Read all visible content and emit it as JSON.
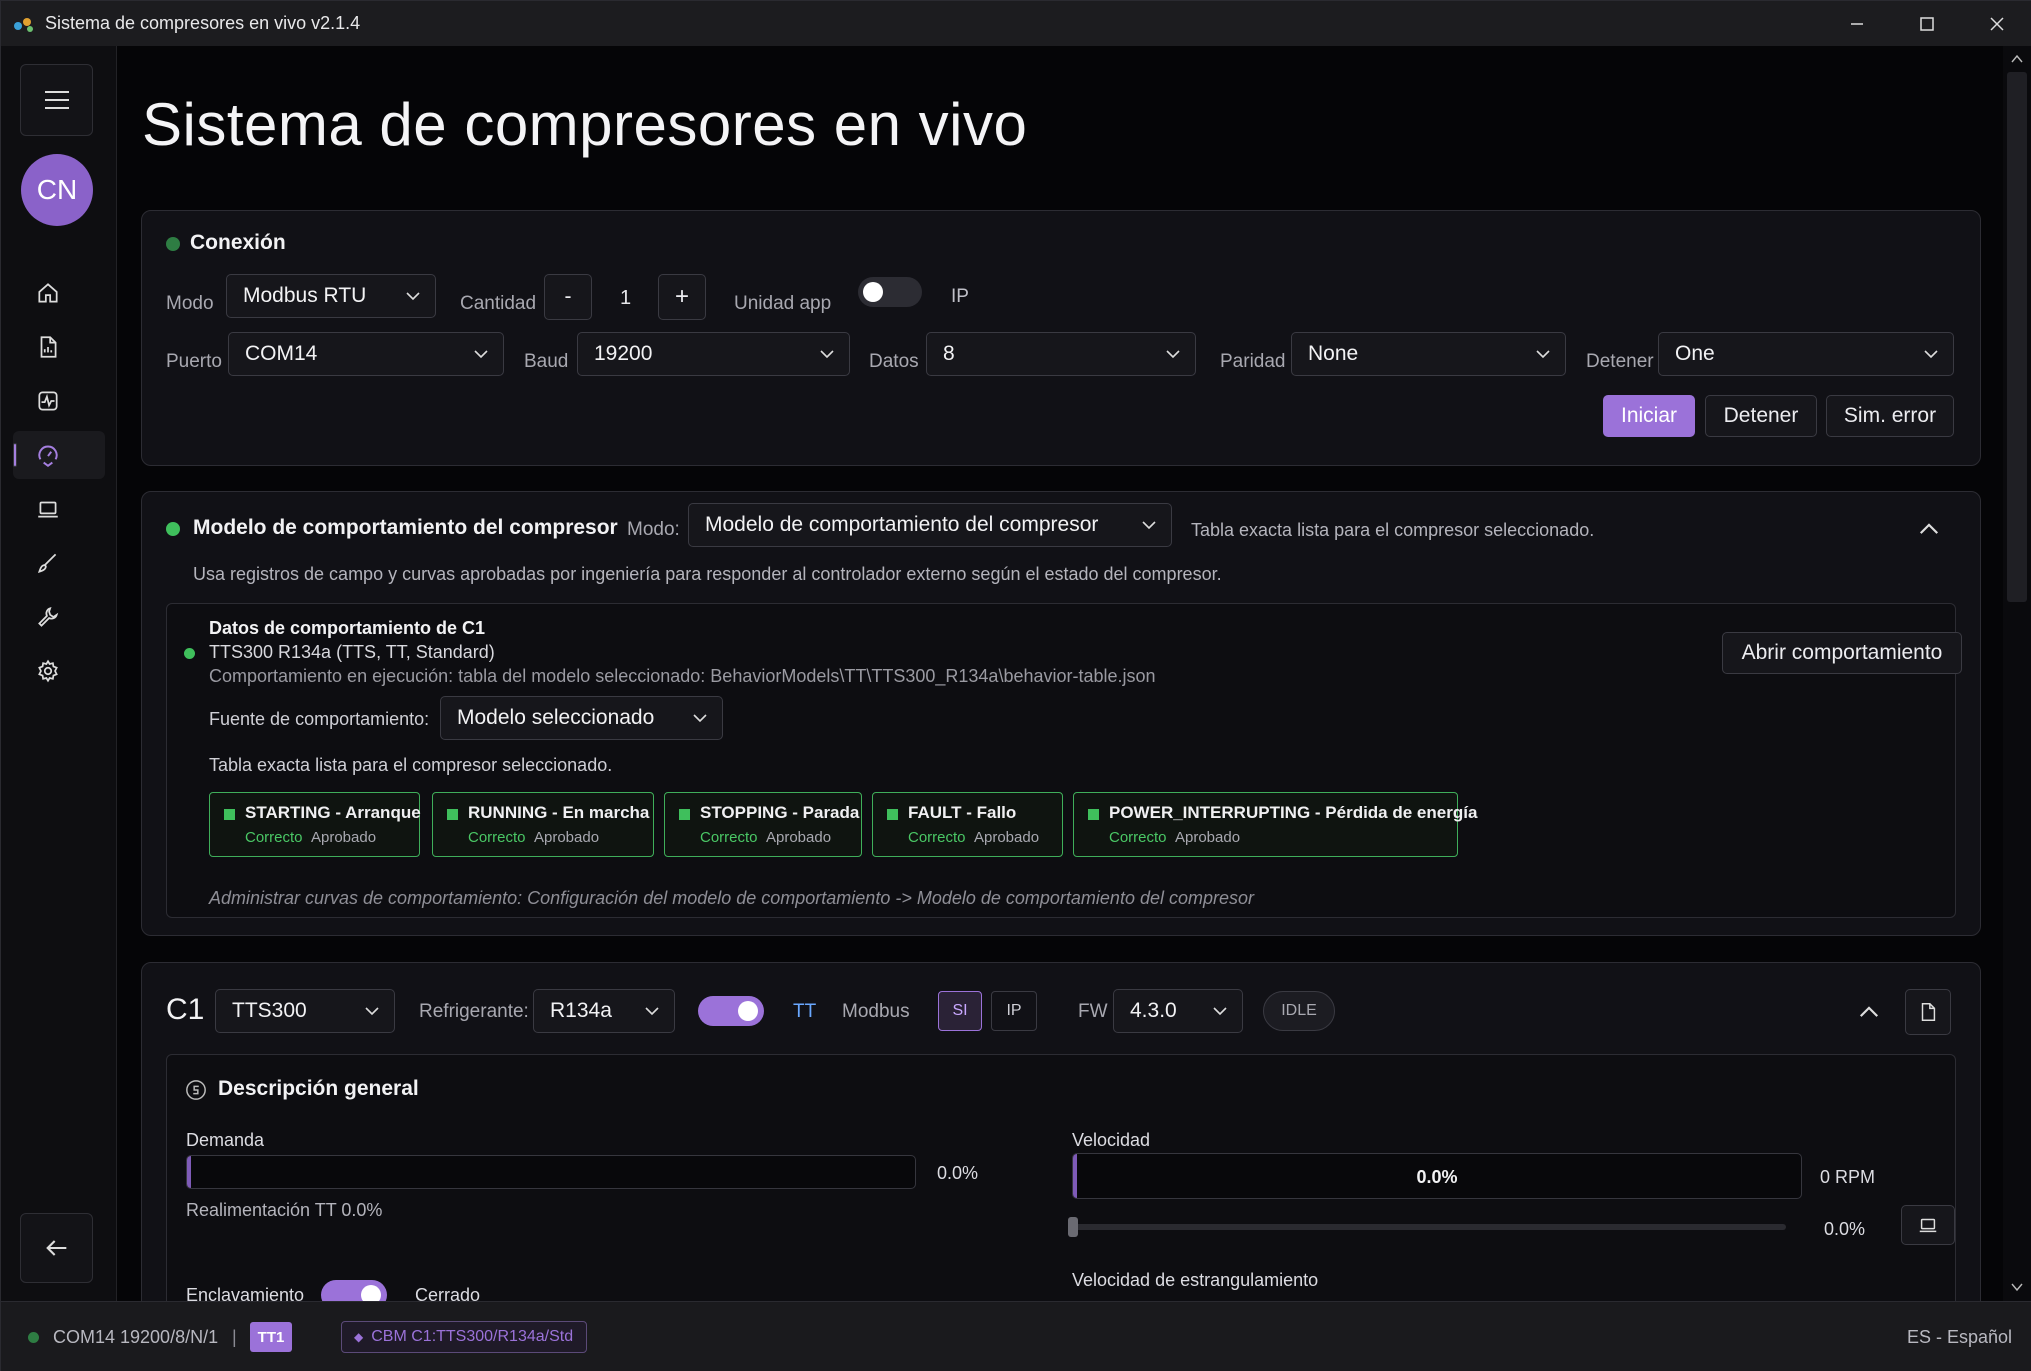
{
  "window": {
    "title": "Sistema de compresores en vivo v2.1.4"
  },
  "sidebar": {
    "avatar": "CN",
    "icons": [
      "home-icon",
      "report-icon",
      "activity-icon",
      "gauge-icon",
      "laptop-icon",
      "brush-icon",
      "wrench-icon",
      "gear-icon"
    ]
  },
  "page": {
    "title": "Sistema de compresores en vivo"
  },
  "connection": {
    "title": "Conexión",
    "mode_label": "Modo",
    "mode_value": "Modbus RTU",
    "qty_label": "Cantidad",
    "qty_minus": "-",
    "qty_value": "1",
    "qty_plus": "+",
    "unit_label": "Unidad app",
    "ip_label": "IP",
    "port_label": "Puerto",
    "port_value": "COM14",
    "baud_label": "Baud",
    "baud_value": "19200",
    "data_label": "Datos",
    "data_value": "8",
    "parity_label": "Paridad",
    "parity_value": "None",
    "stop_label": "Detener",
    "stop_value": "One",
    "start_btn": "Iniciar",
    "stop_btn": "Detener",
    "sim_btn": "Sim. error",
    "status_color": "#2e7d43"
  },
  "behavior": {
    "title": "Modelo de comportamiento del compresor",
    "mode_label": "Modo:",
    "mode_value": "Modelo de comportamiento del compresor",
    "table_note": "Tabla exacta lista para el compresor seleccionado.",
    "description": "Usa registros de campo y curvas aprobadas por ingeniería para responder al controlador externo según el estado del compresor.",
    "data_title": "Datos de comportamiento de C1",
    "model_line": "TTS300 R134a (TTS, TT, Standard)",
    "running_line": "Comportamiento en ejecución: tabla del modelo seleccionado: BehaviorModels\\TT\\TTS300_R134a\\behavior-table.json",
    "open_btn": "Abrir comportamiento",
    "source_label": "Fuente de comportamiento:",
    "source_value": "Modelo seleccionado",
    "table_ready": "Tabla exacta lista para el compresor seleccionado.",
    "states": [
      {
        "name": "STARTING - Arranque",
        "ok": "Correcto",
        "approved": "Aprobado"
      },
      {
        "name": "RUNNING - En marcha",
        "ok": "Correcto",
        "approved": "Aprobado"
      },
      {
        "name": "STOPPING - Parada",
        "ok": "Correcto",
        "approved": "Aprobado"
      },
      {
        "name": "FAULT - Fallo",
        "ok": "Correcto",
        "approved": "Aprobado"
      },
      {
        "name": "POWER_INTERRUPTING - Pérdida de energía",
        "ok": "Correcto",
        "approved": "Aprobado"
      }
    ],
    "admin_note": "Administrar curvas de comportamiento: Configuración del modelo de comportamiento -> Modelo de comportamiento del compresor"
  },
  "compressor": {
    "id": "C1",
    "model": "TTS300",
    "refrigerant_label": "Refrigerante:",
    "refrigerant_value": "R134a",
    "tt_label": "TT",
    "modbus_label": "Modbus",
    "si_label": "SI",
    "ip_label": "IP",
    "fw_label": "FW",
    "fw_value": "4.3.0",
    "state_badge": "IDLE",
    "overview_title": "Descripción general",
    "demand_label": "Demanda",
    "demand_value": "0.0%",
    "demand_fraction": 0.0,
    "feedback": "Realimentación TT 0.0%",
    "speed_label": "Velocidad",
    "speed_bar_value": "0.0%",
    "speed_rpm": "0 RPM",
    "speed_fraction": 0.0,
    "slider_value": "0.0%",
    "latch_label": "Enclavamiento",
    "latch_state": "Cerrado",
    "throttle_label": "Velocidad de estrangulamiento"
  },
  "statusbar": {
    "port": "COM14 19200/8/N/1",
    "sep": "|",
    "badge": "TT1",
    "cbm": "CBM C1:TTS300/R134a/Std",
    "lang": "ES - Español"
  },
  "colors": {
    "accent": "#9b72d9",
    "ok": "#3fbf5c"
  }
}
